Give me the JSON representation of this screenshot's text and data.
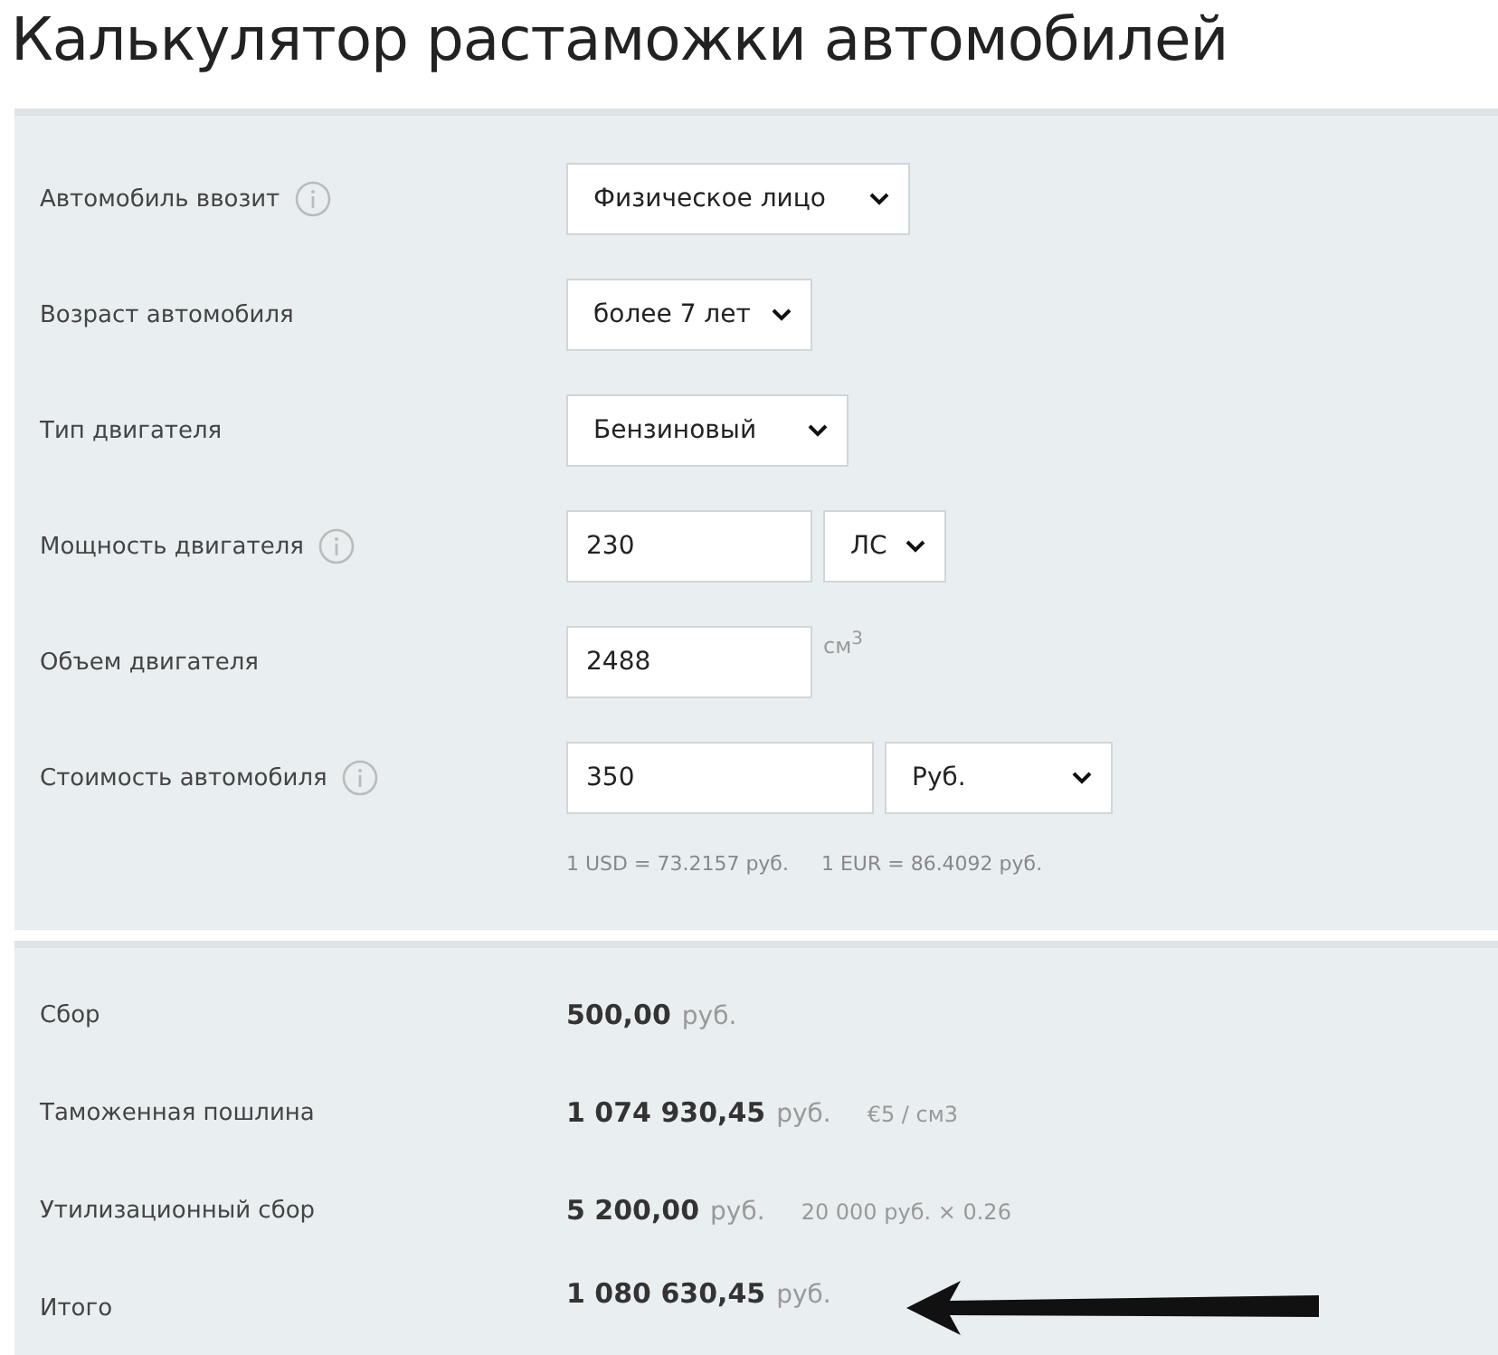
{
  "title": "Калькулятор растаможки автомобилей",
  "form": [
    {
      "label": "Автомобиль ввозит",
      "info": true,
      "controls": [
        {
          "kind": "select",
          "value": "Физическое лицо"
        }
      ]
    },
    {
      "label": "Возраст автомобиля",
      "info": false,
      "controls": [
        {
          "kind": "select",
          "value": "более 7 лет"
        }
      ]
    },
    {
      "label": "Тип двигателя",
      "info": false,
      "controls": [
        {
          "kind": "select",
          "value": "Бензиновый"
        }
      ]
    },
    {
      "label": "Мощность двигателя",
      "info": true,
      "controls": [
        {
          "kind": "input",
          "value": "230"
        },
        {
          "kind": "select",
          "value": "ЛС"
        }
      ]
    },
    {
      "label": "Объем двигателя",
      "info": false,
      "controls": [
        {
          "kind": "input",
          "value": "2488"
        },
        {
          "kind": "unit",
          "value": "см$^{3}$"
        }
      ]
    },
    {
      "label": "Стоимость автомобиля",
      "info": true,
      "controls": [
        {
          "kind": "input",
          "value": "350"
        },
        {
          "kind": "select",
          "value": "Руб."
        }
      ]
    }
  ],
  "rates": [
    "1 USD = 73.2157 руб.",
    "1 EUR = 86.4092 руб."
  ],
  "results": [
    {
      "label": "Сбор",
      "amount": "500,00",
      "currency": "руб."
    },
    {
      "label": "Таможенная пошлина",
      "amount": "1 074 930,45",
      "currency": "руб.",
      "note": "€5 / см3"
    },
    {
      "label": "Утилизационный сбор",
      "amount": "5 200,00",
      "currency": "руб.",
      "note": "20 000 руб. × 0.26"
    },
    {
      "label": "Итого",
      "amount": "1 080 630,45",
      "currency": "руб."
    }
  ]
}
